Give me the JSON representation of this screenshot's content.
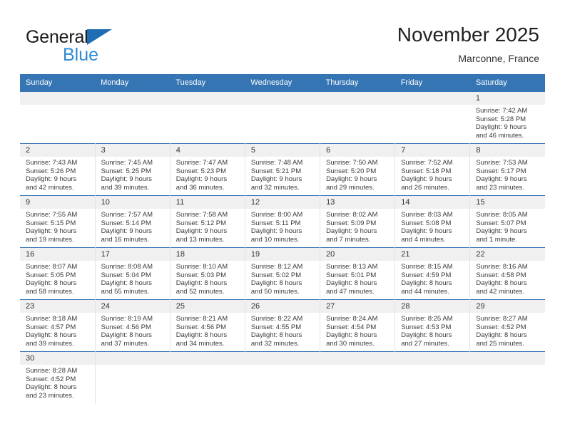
{
  "brand": {
    "name_top": "General",
    "name_bottom": "Blue",
    "triangle_icon": "blue-triangle-icon",
    "color_dark": "#1a1a1a",
    "color_blue": "#2e8bd4",
    "color_triangle": "#1f6eb5"
  },
  "header": {
    "title": "November 2025",
    "subtitle": "Marconne, France"
  },
  "theme": {
    "header_bar": "#3575b4",
    "date_strip": "#f0f0f0",
    "row_divider": "#3575b4",
    "text": "#3a3a3a"
  },
  "columns": [
    "Sunday",
    "Monday",
    "Tuesday",
    "Wednesday",
    "Thursday",
    "Friday",
    "Saturday"
  ],
  "weeks": [
    [
      {
        "day": "",
        "empty": true
      },
      {
        "day": "",
        "empty": true
      },
      {
        "day": "",
        "empty": true
      },
      {
        "day": "",
        "empty": true
      },
      {
        "day": "",
        "empty": true
      },
      {
        "day": "",
        "empty": true
      },
      {
        "day": "1",
        "sunrise": "Sunrise: 7:42 AM",
        "sunset": "Sunset: 5:28 PM",
        "daylight1": "Daylight: 9 hours",
        "daylight2": "and 46 minutes."
      }
    ],
    [
      {
        "day": "2",
        "sunrise": "Sunrise: 7:43 AM",
        "sunset": "Sunset: 5:26 PM",
        "daylight1": "Daylight: 9 hours",
        "daylight2": "and 42 minutes."
      },
      {
        "day": "3",
        "sunrise": "Sunrise: 7:45 AM",
        "sunset": "Sunset: 5:25 PM",
        "daylight1": "Daylight: 9 hours",
        "daylight2": "and 39 minutes."
      },
      {
        "day": "4",
        "sunrise": "Sunrise: 7:47 AM",
        "sunset": "Sunset: 5:23 PM",
        "daylight1": "Daylight: 9 hours",
        "daylight2": "and 36 minutes."
      },
      {
        "day": "5",
        "sunrise": "Sunrise: 7:48 AM",
        "sunset": "Sunset: 5:21 PM",
        "daylight1": "Daylight: 9 hours",
        "daylight2": "and 32 minutes."
      },
      {
        "day": "6",
        "sunrise": "Sunrise: 7:50 AM",
        "sunset": "Sunset: 5:20 PM",
        "daylight1": "Daylight: 9 hours",
        "daylight2": "and 29 minutes."
      },
      {
        "day": "7",
        "sunrise": "Sunrise: 7:52 AM",
        "sunset": "Sunset: 5:18 PM",
        "daylight1": "Daylight: 9 hours",
        "daylight2": "and 26 minutes."
      },
      {
        "day": "8",
        "sunrise": "Sunrise: 7:53 AM",
        "sunset": "Sunset: 5:17 PM",
        "daylight1": "Daylight: 9 hours",
        "daylight2": "and 23 minutes."
      }
    ],
    [
      {
        "day": "9",
        "sunrise": "Sunrise: 7:55 AM",
        "sunset": "Sunset: 5:15 PM",
        "daylight1": "Daylight: 9 hours",
        "daylight2": "and 19 minutes."
      },
      {
        "day": "10",
        "sunrise": "Sunrise: 7:57 AM",
        "sunset": "Sunset: 5:14 PM",
        "daylight1": "Daylight: 9 hours",
        "daylight2": "and 16 minutes."
      },
      {
        "day": "11",
        "sunrise": "Sunrise: 7:58 AM",
        "sunset": "Sunset: 5:12 PM",
        "daylight1": "Daylight: 9 hours",
        "daylight2": "and 13 minutes."
      },
      {
        "day": "12",
        "sunrise": "Sunrise: 8:00 AM",
        "sunset": "Sunset: 5:11 PM",
        "daylight1": "Daylight: 9 hours",
        "daylight2": "and 10 minutes."
      },
      {
        "day": "13",
        "sunrise": "Sunrise: 8:02 AM",
        "sunset": "Sunset: 5:09 PM",
        "daylight1": "Daylight: 9 hours",
        "daylight2": "and 7 minutes."
      },
      {
        "day": "14",
        "sunrise": "Sunrise: 8:03 AM",
        "sunset": "Sunset: 5:08 PM",
        "daylight1": "Daylight: 9 hours",
        "daylight2": "and 4 minutes."
      },
      {
        "day": "15",
        "sunrise": "Sunrise: 8:05 AM",
        "sunset": "Sunset: 5:07 PM",
        "daylight1": "Daylight: 9 hours",
        "daylight2": "and 1 minute."
      }
    ],
    [
      {
        "day": "16",
        "sunrise": "Sunrise: 8:07 AM",
        "sunset": "Sunset: 5:05 PM",
        "daylight1": "Daylight: 8 hours",
        "daylight2": "and 58 minutes."
      },
      {
        "day": "17",
        "sunrise": "Sunrise: 8:08 AM",
        "sunset": "Sunset: 5:04 PM",
        "daylight1": "Daylight: 8 hours",
        "daylight2": "and 55 minutes."
      },
      {
        "day": "18",
        "sunrise": "Sunrise: 8:10 AM",
        "sunset": "Sunset: 5:03 PM",
        "daylight1": "Daylight: 8 hours",
        "daylight2": "and 52 minutes."
      },
      {
        "day": "19",
        "sunrise": "Sunrise: 8:12 AM",
        "sunset": "Sunset: 5:02 PM",
        "daylight1": "Daylight: 8 hours",
        "daylight2": "and 50 minutes."
      },
      {
        "day": "20",
        "sunrise": "Sunrise: 8:13 AM",
        "sunset": "Sunset: 5:01 PM",
        "daylight1": "Daylight: 8 hours",
        "daylight2": "and 47 minutes."
      },
      {
        "day": "21",
        "sunrise": "Sunrise: 8:15 AM",
        "sunset": "Sunset: 4:59 PM",
        "daylight1": "Daylight: 8 hours",
        "daylight2": "and 44 minutes."
      },
      {
        "day": "22",
        "sunrise": "Sunrise: 8:16 AM",
        "sunset": "Sunset: 4:58 PM",
        "daylight1": "Daylight: 8 hours",
        "daylight2": "and 42 minutes."
      }
    ],
    [
      {
        "day": "23",
        "sunrise": "Sunrise: 8:18 AM",
        "sunset": "Sunset: 4:57 PM",
        "daylight1": "Daylight: 8 hours",
        "daylight2": "and 39 minutes."
      },
      {
        "day": "24",
        "sunrise": "Sunrise: 8:19 AM",
        "sunset": "Sunset: 4:56 PM",
        "daylight1": "Daylight: 8 hours",
        "daylight2": "and 37 minutes."
      },
      {
        "day": "25",
        "sunrise": "Sunrise: 8:21 AM",
        "sunset": "Sunset: 4:56 PM",
        "daylight1": "Daylight: 8 hours",
        "daylight2": "and 34 minutes."
      },
      {
        "day": "26",
        "sunrise": "Sunrise: 8:22 AM",
        "sunset": "Sunset: 4:55 PM",
        "daylight1": "Daylight: 8 hours",
        "daylight2": "and 32 minutes."
      },
      {
        "day": "27",
        "sunrise": "Sunrise: 8:24 AM",
        "sunset": "Sunset: 4:54 PM",
        "daylight1": "Daylight: 8 hours",
        "daylight2": "and 30 minutes."
      },
      {
        "day": "28",
        "sunrise": "Sunrise: 8:25 AM",
        "sunset": "Sunset: 4:53 PM",
        "daylight1": "Daylight: 8 hours",
        "daylight2": "and 27 minutes."
      },
      {
        "day": "29",
        "sunrise": "Sunrise: 8:27 AM",
        "sunset": "Sunset: 4:52 PM",
        "daylight1": "Daylight: 8 hours",
        "daylight2": "and 25 minutes."
      }
    ],
    [
      {
        "day": "30",
        "sunrise": "Sunrise: 8:28 AM",
        "sunset": "Sunset: 4:52 PM",
        "daylight1": "Daylight: 8 hours",
        "daylight2": "and 23 minutes."
      },
      {
        "day": "",
        "empty": true
      },
      {
        "day": "",
        "empty": true
      },
      {
        "day": "",
        "empty": true
      },
      {
        "day": "",
        "empty": true
      },
      {
        "day": "",
        "empty": true
      },
      {
        "day": "",
        "empty": true
      }
    ]
  ]
}
